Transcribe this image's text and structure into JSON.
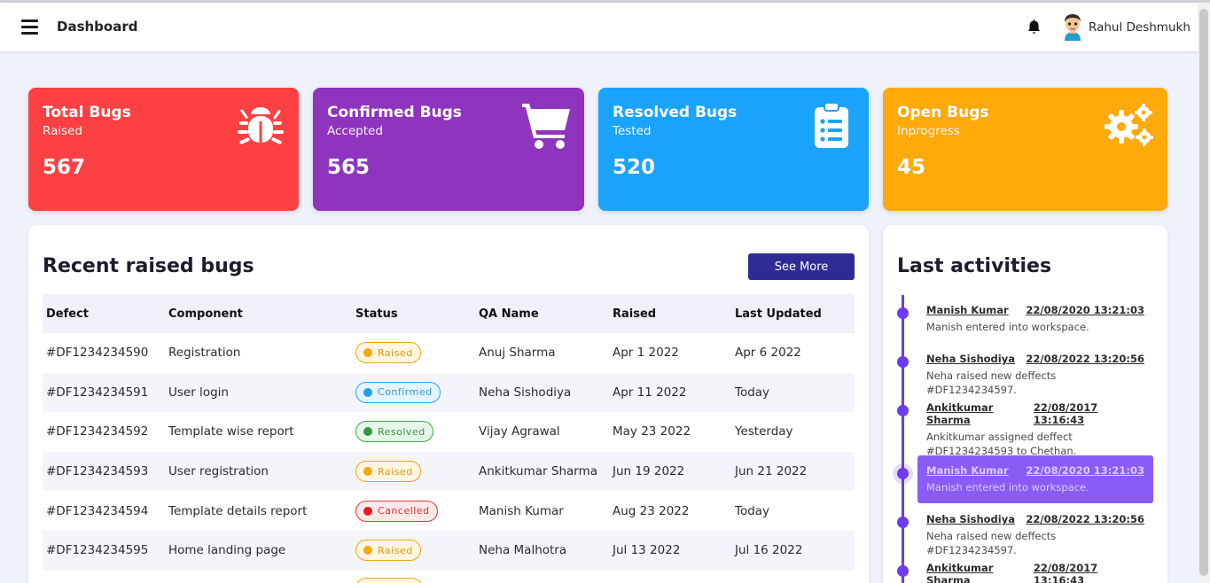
{
  "header": {
    "title": "Dashboard",
    "user_name": "Rahul Deshmukh"
  },
  "stats": [
    {
      "title": "Total Bugs",
      "subtitle": "Raised",
      "value": "567",
      "color": "#fd4041",
      "icon": "bug-icon"
    },
    {
      "title": "Confirmed Bugs",
      "subtitle": "Accepted",
      "value": "565",
      "color": "#8e34be",
      "icon": "cart-icon"
    },
    {
      "title": "Resolved Bugs",
      "subtitle": "Tested",
      "value": "520",
      "color": "#1aa3fb",
      "icon": "clipboard-list-icon"
    },
    {
      "title": "Open Bugs",
      "subtitle": "Inprogress",
      "value": "45",
      "color": "#ffa90a",
      "icon": "gears-icon"
    }
  ],
  "recent": {
    "title": "Recent raised bugs",
    "see_more_label": "See More",
    "columns": [
      "Defect",
      "Component",
      "Status",
      "QA Name",
      "Raised",
      "Last Updated"
    ],
    "rows": [
      {
        "defect": "#DF1234234590",
        "component": "Registration",
        "status": "Raised",
        "qa": "Anuj Sharma",
        "raised": "Apr 1 2022",
        "updated": "Apr 6 2022"
      },
      {
        "defect": "#DF1234234591",
        "component": "User login",
        "status": "Confirmed",
        "qa": "Neha Sishodiya",
        "raised": "Apr 11 2022",
        "updated": "Today"
      },
      {
        "defect": "#DF1234234592",
        "component": "Template wise report",
        "status": "Resolved",
        "qa": "Vijay Agrawal",
        "raised": "May 23 2022",
        "updated": "Yesterday"
      },
      {
        "defect": "#DF1234234593",
        "component": "User registration",
        "status": "Raised",
        "qa": "Ankitkumar Sharma",
        "raised": "Jun 19 2022",
        "updated": "Jun 21 2022"
      },
      {
        "defect": "#DF1234234594",
        "component": "Template details report",
        "status": "Cancelled",
        "qa": "Manish Kumar",
        "raised": "Aug 23 2022",
        "updated": "Today"
      },
      {
        "defect": "#DF1234234595",
        "component": "Home landing page",
        "status": "Raised",
        "qa": "Neha Malhotra",
        "raised": "Jul 13 2022",
        "updated": "Jul 16 2022"
      }
    ]
  },
  "activities": {
    "title": "Last activities",
    "items": [
      {
        "name": "Manish Kumar",
        "time": "22/08/2020 13:21:03",
        "text": "Manish entered into workspace.",
        "active": false
      },
      {
        "name": "Neha Sishodiya",
        "time": "22/08/2022 13:20:56",
        "text": "Neha raised new deffects #DF1234234597.",
        "active": false
      },
      {
        "name": "Ankitkumar Sharma",
        "time": "22/08/2017 13:16:43",
        "text": "Ankitkumar assigned deffect #DF1234234593 to Chethan.",
        "active": false
      },
      {
        "name": "Manish Kumar",
        "time": "22/08/2020 13:21:03",
        "text": "Manish entered into workspace.",
        "active": true
      },
      {
        "name": "Neha Sishodiya",
        "time": "22/08/2022 13:20:56",
        "text": "Neha raised new deffects #DF1234234597.",
        "active": false
      },
      {
        "name": "Ankitkumar Sharma",
        "time": "22/08/2017 13:16:43",
        "text": "",
        "active": false
      }
    ]
  }
}
